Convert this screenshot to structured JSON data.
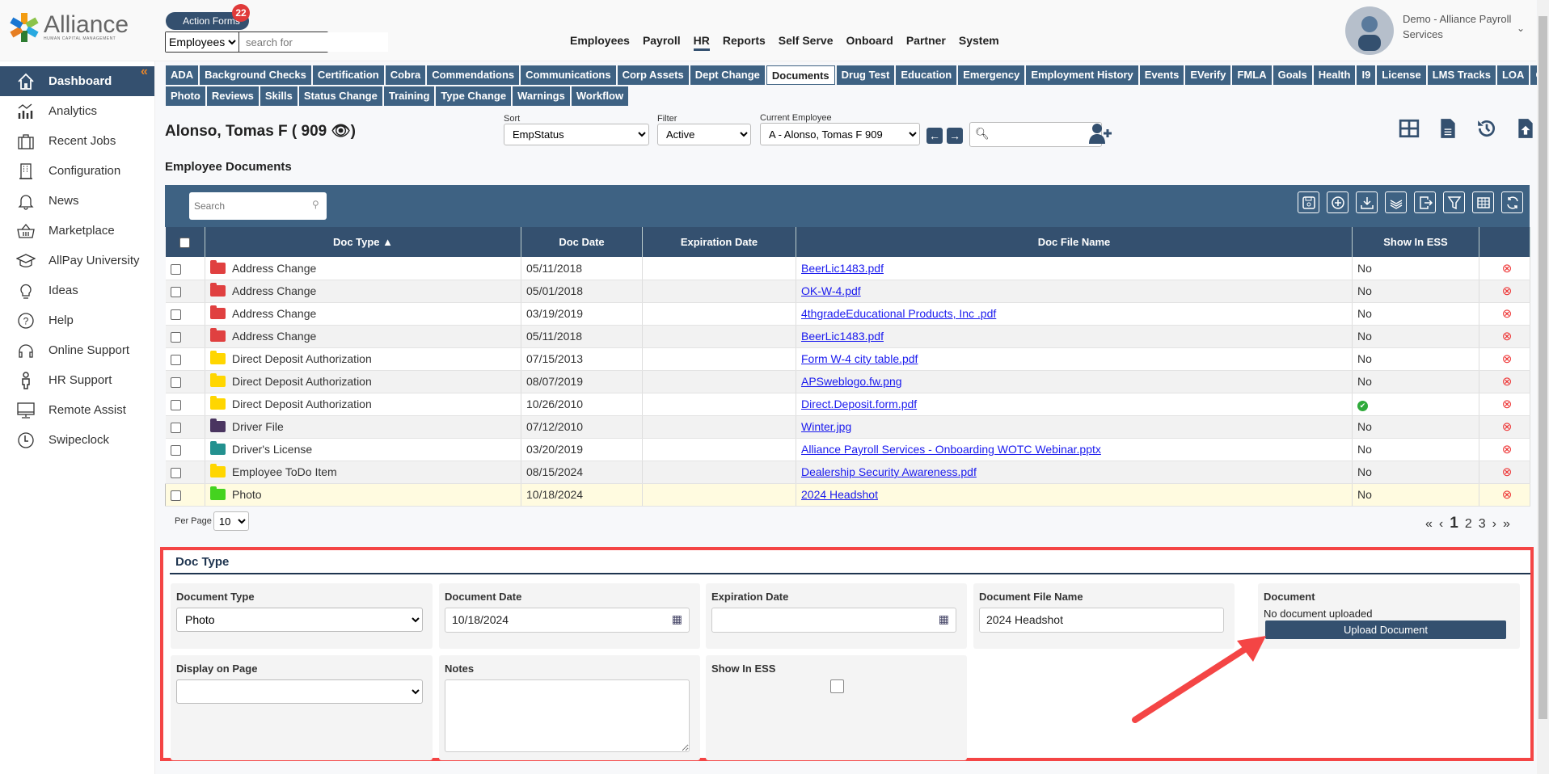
{
  "header": {
    "logo_text": "Alliance",
    "logo_sub": "HUMAN CAPITAL MANAGEMENT",
    "action_forms": "Action Forms",
    "action_badge": "22",
    "search_scope": "Employees",
    "search_placeholder": "search for",
    "nav": [
      "Employees",
      "Payroll",
      "HR",
      "Reports",
      "Self Serve",
      "Onboard",
      "Partner",
      "System"
    ],
    "active_nav": "HR",
    "user_line1": "Demo - Alliance Payroll",
    "user_line2": "Services"
  },
  "sidebar": {
    "items": [
      {
        "label": "Dashboard",
        "icon": "home-icon"
      },
      {
        "label": "Analytics",
        "icon": "analytics-icon"
      },
      {
        "label": "Recent Jobs",
        "icon": "briefcase-icon"
      },
      {
        "label": "Configuration",
        "icon": "building-icon"
      },
      {
        "label": "News",
        "icon": "bell-icon"
      },
      {
        "label": "Marketplace",
        "icon": "basket-icon"
      },
      {
        "label": "AllPay University",
        "icon": "graduation-cap-icon"
      },
      {
        "label": "Ideas",
        "icon": "lightbulb-icon"
      },
      {
        "label": "Help",
        "icon": "question-icon"
      },
      {
        "label": "Online Support",
        "icon": "headphones-icon"
      },
      {
        "label": "HR Support",
        "icon": "person-icon"
      },
      {
        "label": "Remote Assist",
        "icon": "monitor-icon"
      },
      {
        "label": "Swipeclock",
        "icon": "clock-icon"
      }
    ]
  },
  "tabs_row1": [
    "ADA",
    "Background Checks",
    "Certification",
    "Cobra",
    "Commendations",
    "Communications",
    "Corp Assets",
    "Dept Change",
    "Documents",
    "Drug Test",
    "Education",
    "Emergency",
    "Employment History",
    "Events",
    "EVerify",
    "FMLA",
    "Goals",
    "Health",
    "I9",
    "License",
    "LMS Tracks",
    "LOA",
    "OSHA"
  ],
  "tabs_row2": [
    "Photo",
    "Reviews",
    "Skills",
    "Status Change",
    "Training",
    "Type Change",
    "Warnings",
    "Workflow"
  ],
  "active_tab": "Documents",
  "employee": {
    "name": "Alonso, Tomas F ( 909",
    "sort_label": "Sort",
    "sort_value": "EmpStatus",
    "filter_label": "Filter",
    "filter_value": "Active",
    "current_label": "Current Employee",
    "current_value": "A - Alonso, Tomas F 909"
  },
  "section_title": "Employee Documents",
  "table": {
    "search_placeholder": "Search",
    "columns": [
      "Doc Type ▲",
      "Doc Date",
      "Expiration Date",
      "Doc File Name",
      "Show In ESS"
    ],
    "rows": [
      {
        "type": "Address Change",
        "color": "#e04040",
        "date": "05/11/2018",
        "exp": "",
        "file": "BeerLic1483.pdf",
        "ess": "No"
      },
      {
        "type": "Address Change",
        "color": "#e04040",
        "date": "05/01/2018",
        "exp": "",
        "file": "OK-W-4.pdf",
        "ess": "No"
      },
      {
        "type": "Address Change",
        "color": "#e04040",
        "date": "03/19/2019",
        "exp": "",
        "file": "4thgradeEducational Products, Inc .pdf",
        "ess": "No"
      },
      {
        "type": "Address Change",
        "color": "#e04040",
        "date": "05/11/2018",
        "exp": "",
        "file": "BeerLic1483.pdf",
        "ess": "No"
      },
      {
        "type": "Direct Deposit Authorization",
        "color": "#ffd600",
        "date": "07/15/2013",
        "exp": "",
        "file": "Form W-4 city table.pdf",
        "ess": "No"
      },
      {
        "type": "Direct Deposit Authorization",
        "color": "#ffd600",
        "date": "08/07/2019",
        "exp": "",
        "file": "APSweblogo.fw.png",
        "ess": "No"
      },
      {
        "type": "Direct Deposit Authorization",
        "color": "#ffd600",
        "date": "10/26/2010",
        "exp": "",
        "file": "Direct.Deposit.form.pdf",
        "ess": "✔"
      },
      {
        "type": "Driver File",
        "color": "#4a3560",
        "date": "07/12/2010",
        "exp": "",
        "file": "Winter.jpg",
        "ess": "No"
      },
      {
        "type": "Driver's License",
        "color": "#23918f",
        "date": "03/20/2019",
        "exp": "",
        "file": "Alliance Payroll Services - Onboarding WOTC Webinar.pptx",
        "ess": "No"
      },
      {
        "type": "Employee ToDo Item",
        "color": "#ffd600",
        "date": "08/15/2024",
        "exp": "",
        "file": "Dealership Security Awareness.pdf",
        "ess": "No"
      },
      {
        "type": "Photo",
        "color": "#44d31f",
        "date": "10/18/2024",
        "exp": "",
        "file": "2024 Headshot",
        "ess": "No"
      }
    ]
  },
  "pagination": {
    "per_page_label": "Per Page",
    "per_page": "10",
    "pages": [
      "1",
      "2",
      "3"
    ],
    "current": "1"
  },
  "form": {
    "heading": "Doc Type",
    "document_type_label": "Document Type",
    "document_type": "Photo",
    "document_date_label": "Document Date",
    "document_date": "10/18/2024",
    "expiration_label": "Expiration Date",
    "expiration": "",
    "file_name_label": "Document File Name",
    "file_name": "2024 Headshot",
    "document_label": "Document",
    "document_status": "No document uploaded",
    "upload_label": "Upload Document",
    "display_label": "Display on Page",
    "notes_label": "Notes",
    "ess_label": "Show In ESS"
  },
  "colors": {
    "primary": "#34506f",
    "tab": "#3e6283",
    "highlight_box": "#f44545",
    "badge": "#e03a3a"
  }
}
